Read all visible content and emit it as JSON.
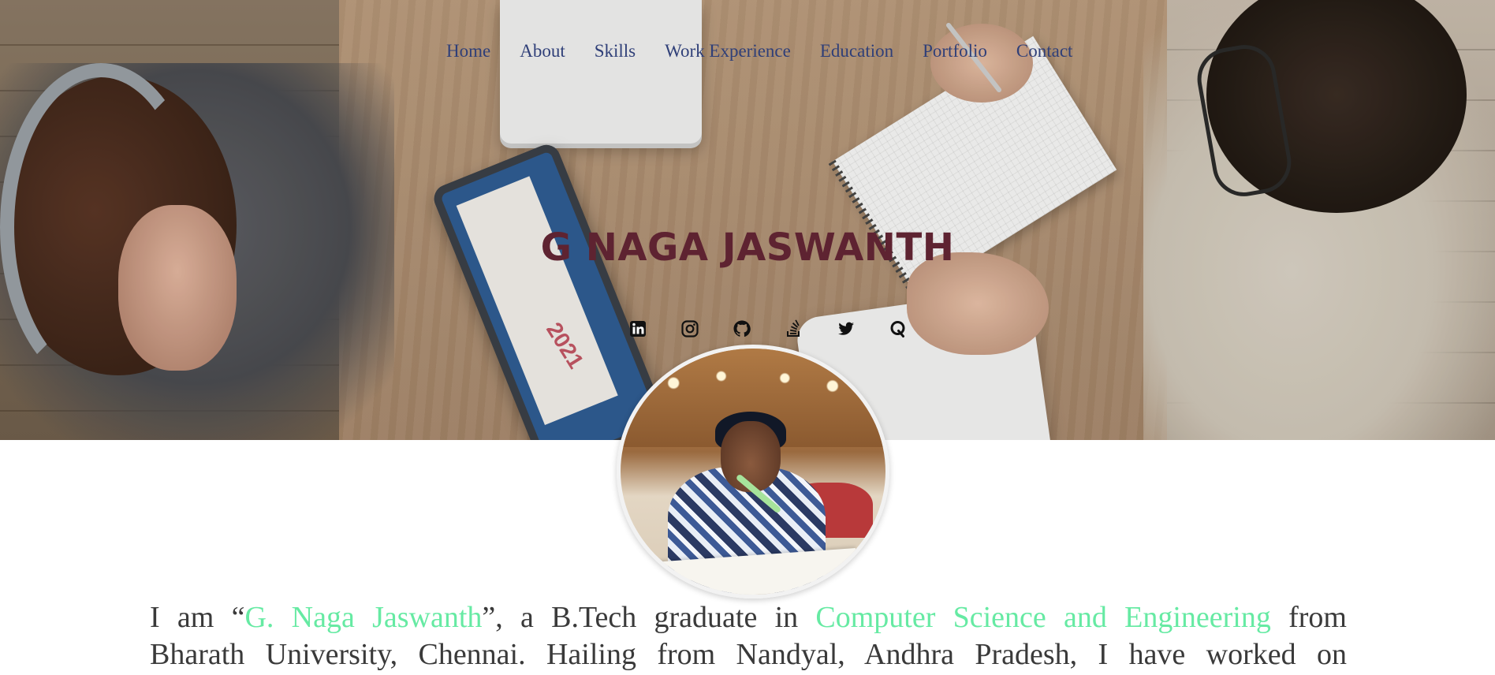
{
  "nav": {
    "items": [
      "Home",
      "About",
      "Skills",
      "Work Experience",
      "Education",
      "Portfolio",
      "Contact"
    ]
  },
  "hero": {
    "name": "G NAGA JASWANTH",
    "name_color": "#5e2331"
  },
  "social": {
    "icons": [
      "linkedin-icon",
      "instagram-icon",
      "github-icon",
      "stackoverflow-icon",
      "twitter-icon",
      "quora-icon"
    ]
  },
  "bio": {
    "line1_prefix": "I am “",
    "name": "G. Naga Jaswanth",
    "line1_mid": "”, a B.Tech graduate in ",
    "degree": "Computer Science and Engineering",
    "line1_suffix": " from",
    "line2": "Bharath University, Chennai. Hailing from Nandyal, Andhra Pradesh, I have worked on",
    "highlight_color": "#66eaa3"
  },
  "colors": {
    "nav_link": "#2f3f78",
    "text": "#3a3a3a"
  }
}
